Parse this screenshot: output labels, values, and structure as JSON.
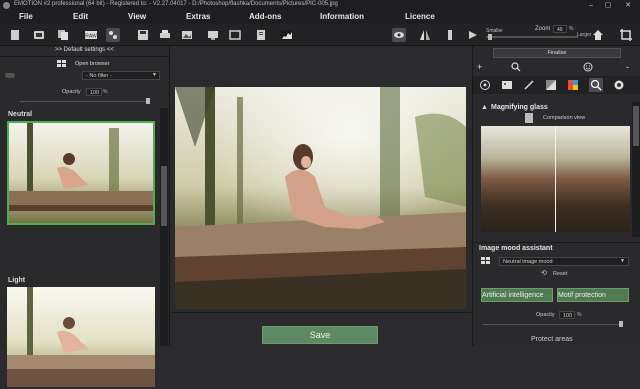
{
  "window": {
    "title": "EMOTION #2 professional (64 bit) - Registered to: - V2.27.04017 - D:/Photoshop/flashka/Documents/Pictures/PIC-005.jpg",
    "minimize": "–",
    "maximize": "▢",
    "close": "✕"
  },
  "menu": {
    "file": "File",
    "edit": "Edit",
    "view": "View",
    "extras": "Extras",
    "addons": "Add-ons",
    "information": "Information",
    "licence": "Licence"
  },
  "toolbar": {
    "zoom_label": "Zoom",
    "zoom_value": "49",
    "zoom_unit": "%",
    "smaller": "Smaller",
    "larger": "Larger"
  },
  "left": {
    "default_settings": ">> Default settings <<",
    "open_browser": "Open browser",
    "filter": "- No filter -",
    "opacity_label": "Opacity",
    "opacity_value": "100",
    "opacity_unit": "%",
    "preset1": "Neutral",
    "preset2": "Light"
  },
  "center": {
    "save": "Save"
  },
  "right": {
    "finalise": "Finalise",
    "magnifying_glass": "Magnifying glass",
    "comparison_view": "Comparison view",
    "mood_assistant": "Image mood assistant",
    "mood_value": "Neutral image mood",
    "reset": "Reset",
    "ai": "Artificial intelligence",
    "motif": "Motif protection",
    "opacity_label": "Opacity",
    "opacity_value": "100",
    "opacity_unit": "%",
    "protect_areas": "Protect areas"
  },
  "colors": {
    "accent_green": "#4caf50",
    "save_green": "#5e8a63"
  }
}
